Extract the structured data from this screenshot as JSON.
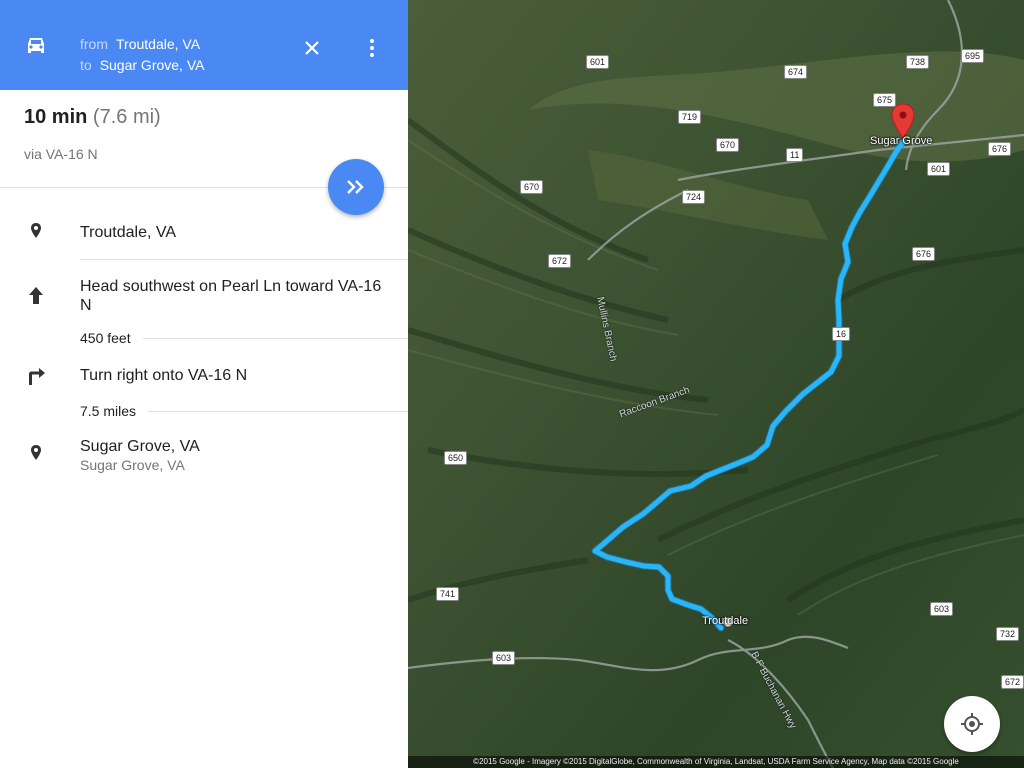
{
  "header": {
    "from_label": "from",
    "from_value": "Troutdale, VA",
    "to_label": "to",
    "to_value": "Sugar Grove, VA",
    "car_icon": "car-icon",
    "close_icon": "close-icon",
    "more_icon": "more-vert-icon",
    "bg_color": "#4a89f3"
  },
  "summary": {
    "time": "10 min",
    "distance": "(7.6 mi)",
    "via": "via VA-16 N",
    "nav_icon": "double-chevron-right-icon"
  },
  "steps": [
    {
      "icon": "place-pin-icon",
      "text": "Troutdale, VA"
    },
    {
      "icon": "arrow-up-icon",
      "text": "Head southwest on Pearl Ln toward VA-16 N",
      "distance": "450 feet"
    },
    {
      "icon": "turn-right-icon",
      "text": "Turn right onto VA-16 N",
      "distance": "7.5 miles"
    },
    {
      "icon": "place-pin-icon",
      "text": "Sugar Grove, VA",
      "sub": "Sugar Grove, VA"
    }
  ],
  "map": {
    "places": {
      "start": "Troutdale",
      "end": "Sugar Grove"
    },
    "roads": {
      "r601a": "601",
      "r674": "674",
      "r738": "738",
      "r695": "695",
      "r675": "675",
      "r719": "719",
      "r670a": "670",
      "r11": "11",
      "r676a": "676",
      "r601b": "601",
      "r670b": "670",
      "r724": "724",
      "r672a": "672",
      "r676b": "676",
      "r16": "16",
      "r650": "650",
      "r741": "741",
      "r603a": "603",
      "r603b": "603",
      "r732": "732",
      "r672b": "672"
    },
    "streams": {
      "mullins": "Mullins Branch",
      "raccoon": "Raccoon Branch",
      "hwy": "B F Buchanan Hwy"
    },
    "route_color": "#29b6f6",
    "marker_color": "#e53935",
    "locate_icon": "my-location-icon",
    "attribution": "©2015 Google - Imagery ©2015 DigitalGlobe, Commonwealth of Virginia, Landsat, USDA Farm Service Agency, Map data ©2015 Google"
  }
}
